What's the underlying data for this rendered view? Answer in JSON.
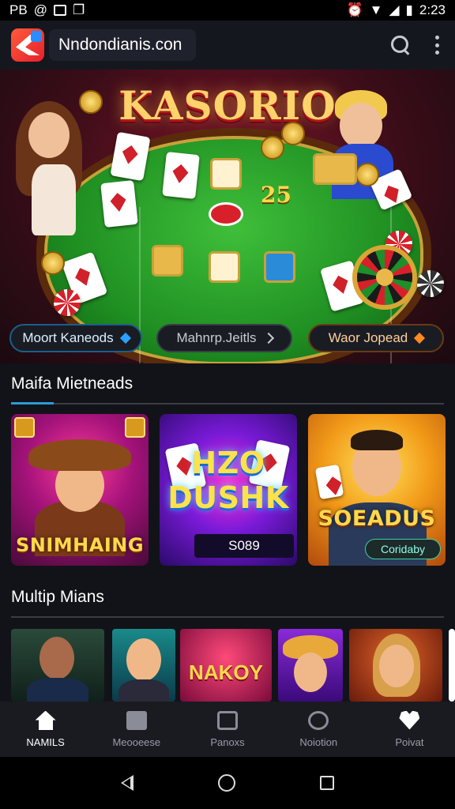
{
  "status_bar": {
    "left_text": "PB",
    "time": "2:23"
  },
  "app_bar": {
    "url": "Nndondianis.con"
  },
  "hero": {
    "title": "KASORIO",
    "amount_text": "25"
  },
  "category_chips": [
    {
      "label": "Moort Kaneods"
    },
    {
      "label": "Mahnrp.Jeitls"
    },
    {
      "label": "Waor Jopead"
    }
  ],
  "section_1": {
    "title": "Maifa Mietneads"
  },
  "games": [
    {
      "label": "SNIMHAING"
    },
    {
      "label": "HZO DUSHK",
      "price": "S089"
    },
    {
      "label": "SOEADUS",
      "sub": "Coridaby"
    }
  ],
  "section_2": {
    "title": "Multip Mians"
  },
  "strip": {
    "label": "NAKOY"
  },
  "bottom_nav": [
    {
      "label": "NAMILS",
      "icon": "home-icon",
      "active": true
    },
    {
      "label": "Meooeese",
      "icon": "box-icon"
    },
    {
      "label": "Panoxs",
      "icon": "bag-icon"
    },
    {
      "label": "Noiotion",
      "icon": "gear-icon"
    },
    {
      "label": "Poivat",
      "icon": "heart-icon"
    }
  ],
  "colors": {
    "accent": "#2a9cd8",
    "background": "#121318",
    "gold": "#ffd36b"
  }
}
